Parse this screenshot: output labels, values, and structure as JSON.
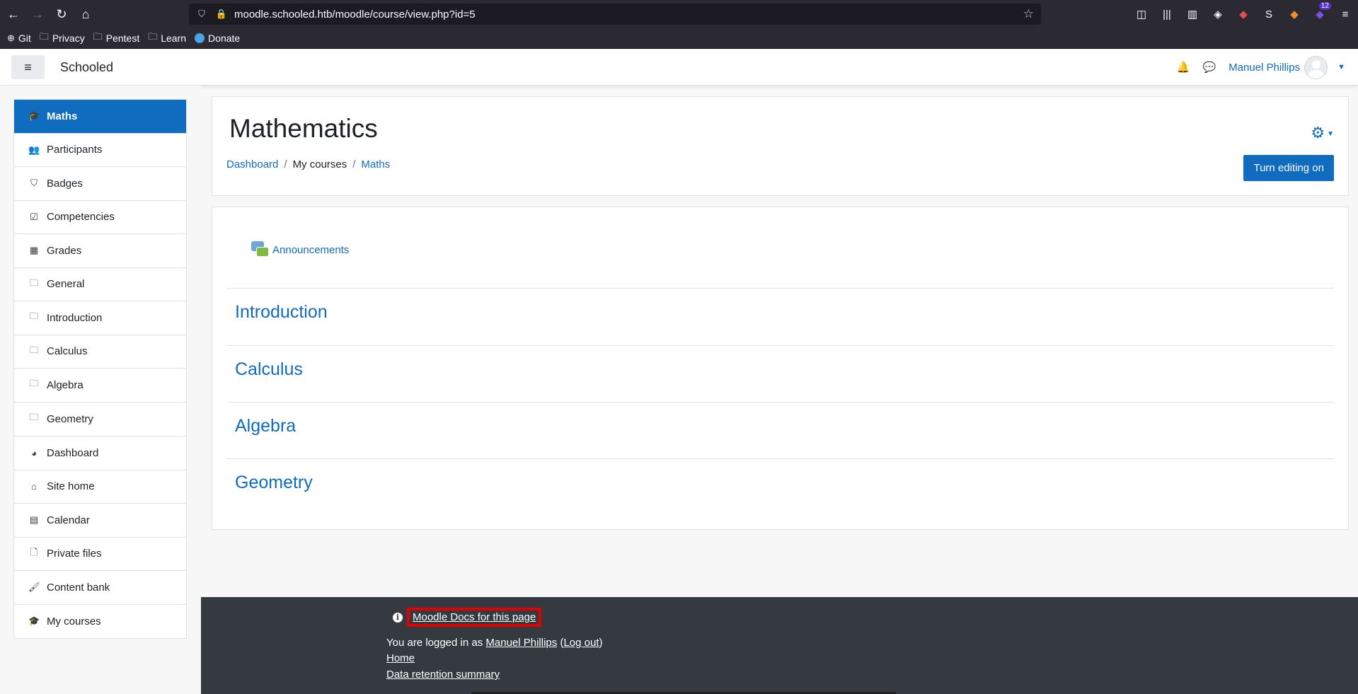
{
  "browser": {
    "url": "moodle.schooled.htb/moodle/course/view.php?id=5",
    "notification_count": "12",
    "bookmarks": [
      "Git",
      "Privacy",
      "Pentest",
      "Learn",
      "Donate"
    ]
  },
  "header": {
    "brand": "Schooled",
    "user_name": "Manuel Phillips"
  },
  "sidebar": {
    "course_items": [
      {
        "label": "Maths",
        "icon": "graduation-cap-icon",
        "glyph": "🎓"
      },
      {
        "label": "Participants",
        "icon": "users-icon",
        "glyph": "👥"
      },
      {
        "label": "Badges",
        "icon": "shield-icon",
        "glyph": "⛉"
      },
      {
        "label": "Competencies",
        "icon": "checkbox-icon",
        "glyph": "☑"
      },
      {
        "label": "Grades",
        "icon": "table-icon",
        "glyph": "▦"
      },
      {
        "label": "General",
        "icon": "folder-icon",
        "glyph": "🗀"
      },
      {
        "label": "Introduction",
        "icon": "folder-icon",
        "glyph": "🗀"
      },
      {
        "label": "Calculus",
        "icon": "folder-icon",
        "glyph": "🗀"
      },
      {
        "label": "Algebra",
        "icon": "folder-icon",
        "glyph": "🗀"
      },
      {
        "label": "Geometry",
        "icon": "folder-icon",
        "glyph": "🗀"
      }
    ],
    "site_items": [
      {
        "label": "Dashboard",
        "icon": "dashboard-icon",
        "glyph": "◕"
      },
      {
        "label": "Site home",
        "icon": "home-icon",
        "glyph": "⌂"
      },
      {
        "label": "Calendar",
        "icon": "calendar-icon",
        "glyph": "▤"
      },
      {
        "label": "Private files",
        "icon": "file-icon",
        "glyph": "🗋"
      },
      {
        "label": "Content bank",
        "icon": "brush-icon",
        "glyph": "🖌"
      },
      {
        "label": "My courses",
        "icon": "graduation-cap-icon",
        "glyph": "🎓"
      }
    ]
  },
  "main": {
    "title": "Mathematics",
    "breadcrumb": {
      "dashboard": "Dashboard",
      "my_courses": "My courses",
      "maths": "Maths"
    },
    "edit_button": "Turn editing on",
    "announcements": "Announcements",
    "sections": [
      "Introduction",
      "Calculus",
      "Algebra",
      "Geometry"
    ]
  },
  "footer": {
    "docs_link": "Moodle Docs for this page",
    "logged_in_prefix": "You are logged in as ",
    "user_name": "Manuel Phillips",
    "logout_open": " (",
    "logout": "Log out",
    "logout_close": ")",
    "home": "Home",
    "data_retention": "Data retention summary"
  },
  "colors": {
    "brand_blue": "#0f6cbf",
    "footer_bg": "#343a40",
    "highlight": "#e30000"
  }
}
